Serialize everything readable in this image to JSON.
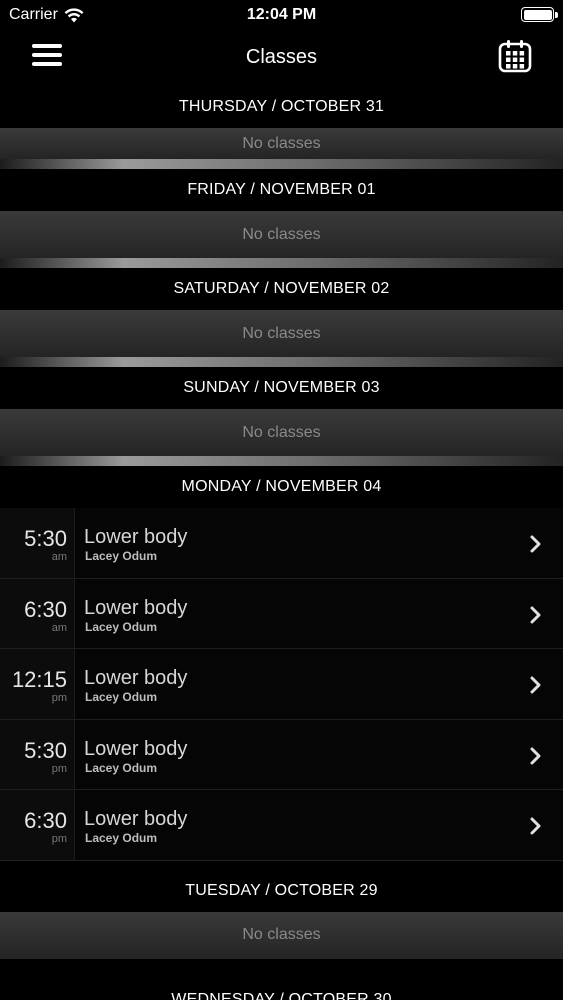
{
  "status_bar": {
    "carrier": "Carrier",
    "time": "12:04 PM"
  },
  "nav": {
    "title": "Classes",
    "menu_icon": "hamburger-menu-icon",
    "calendar_icon": "calendar-icon"
  },
  "days": [
    {
      "header": "THURSDAY / OCTOBER 31",
      "empty_label": "No classes"
    },
    {
      "header": "FRIDAY / NOVEMBER 01",
      "empty_label": "No classes"
    },
    {
      "header": "SATURDAY / NOVEMBER 02",
      "empty_label": "No classes"
    },
    {
      "header": "SUNDAY / NOVEMBER 03",
      "empty_label": "No classes"
    },
    {
      "header": "MONDAY / NOVEMBER 04",
      "classes": [
        {
          "time": "5:30",
          "ampm": "am",
          "name": "Lower body",
          "instructor": "Lacey Odum"
        },
        {
          "time": "6:30",
          "ampm": "am",
          "name": "Lower body",
          "instructor": "Lacey Odum"
        },
        {
          "time": "12:15",
          "ampm": "pm",
          "name": "Lower body",
          "instructor": "Lacey Odum"
        },
        {
          "time": "5:30",
          "ampm": "pm",
          "name": "Lower body",
          "instructor": "Lacey Odum"
        },
        {
          "time": "6:30",
          "ampm": "pm",
          "name": "Lower body",
          "instructor": "Lacey Odum"
        }
      ]
    },
    {
      "header": "TUESDAY / OCTOBER 29",
      "empty_label": "No classes"
    },
    {
      "header": "WEDNESDAY / OCTOBER 30"
    }
  ],
  "colors": {
    "background": "#000000",
    "row_background": "#050505",
    "empty_text": "#8a8a8a"
  }
}
